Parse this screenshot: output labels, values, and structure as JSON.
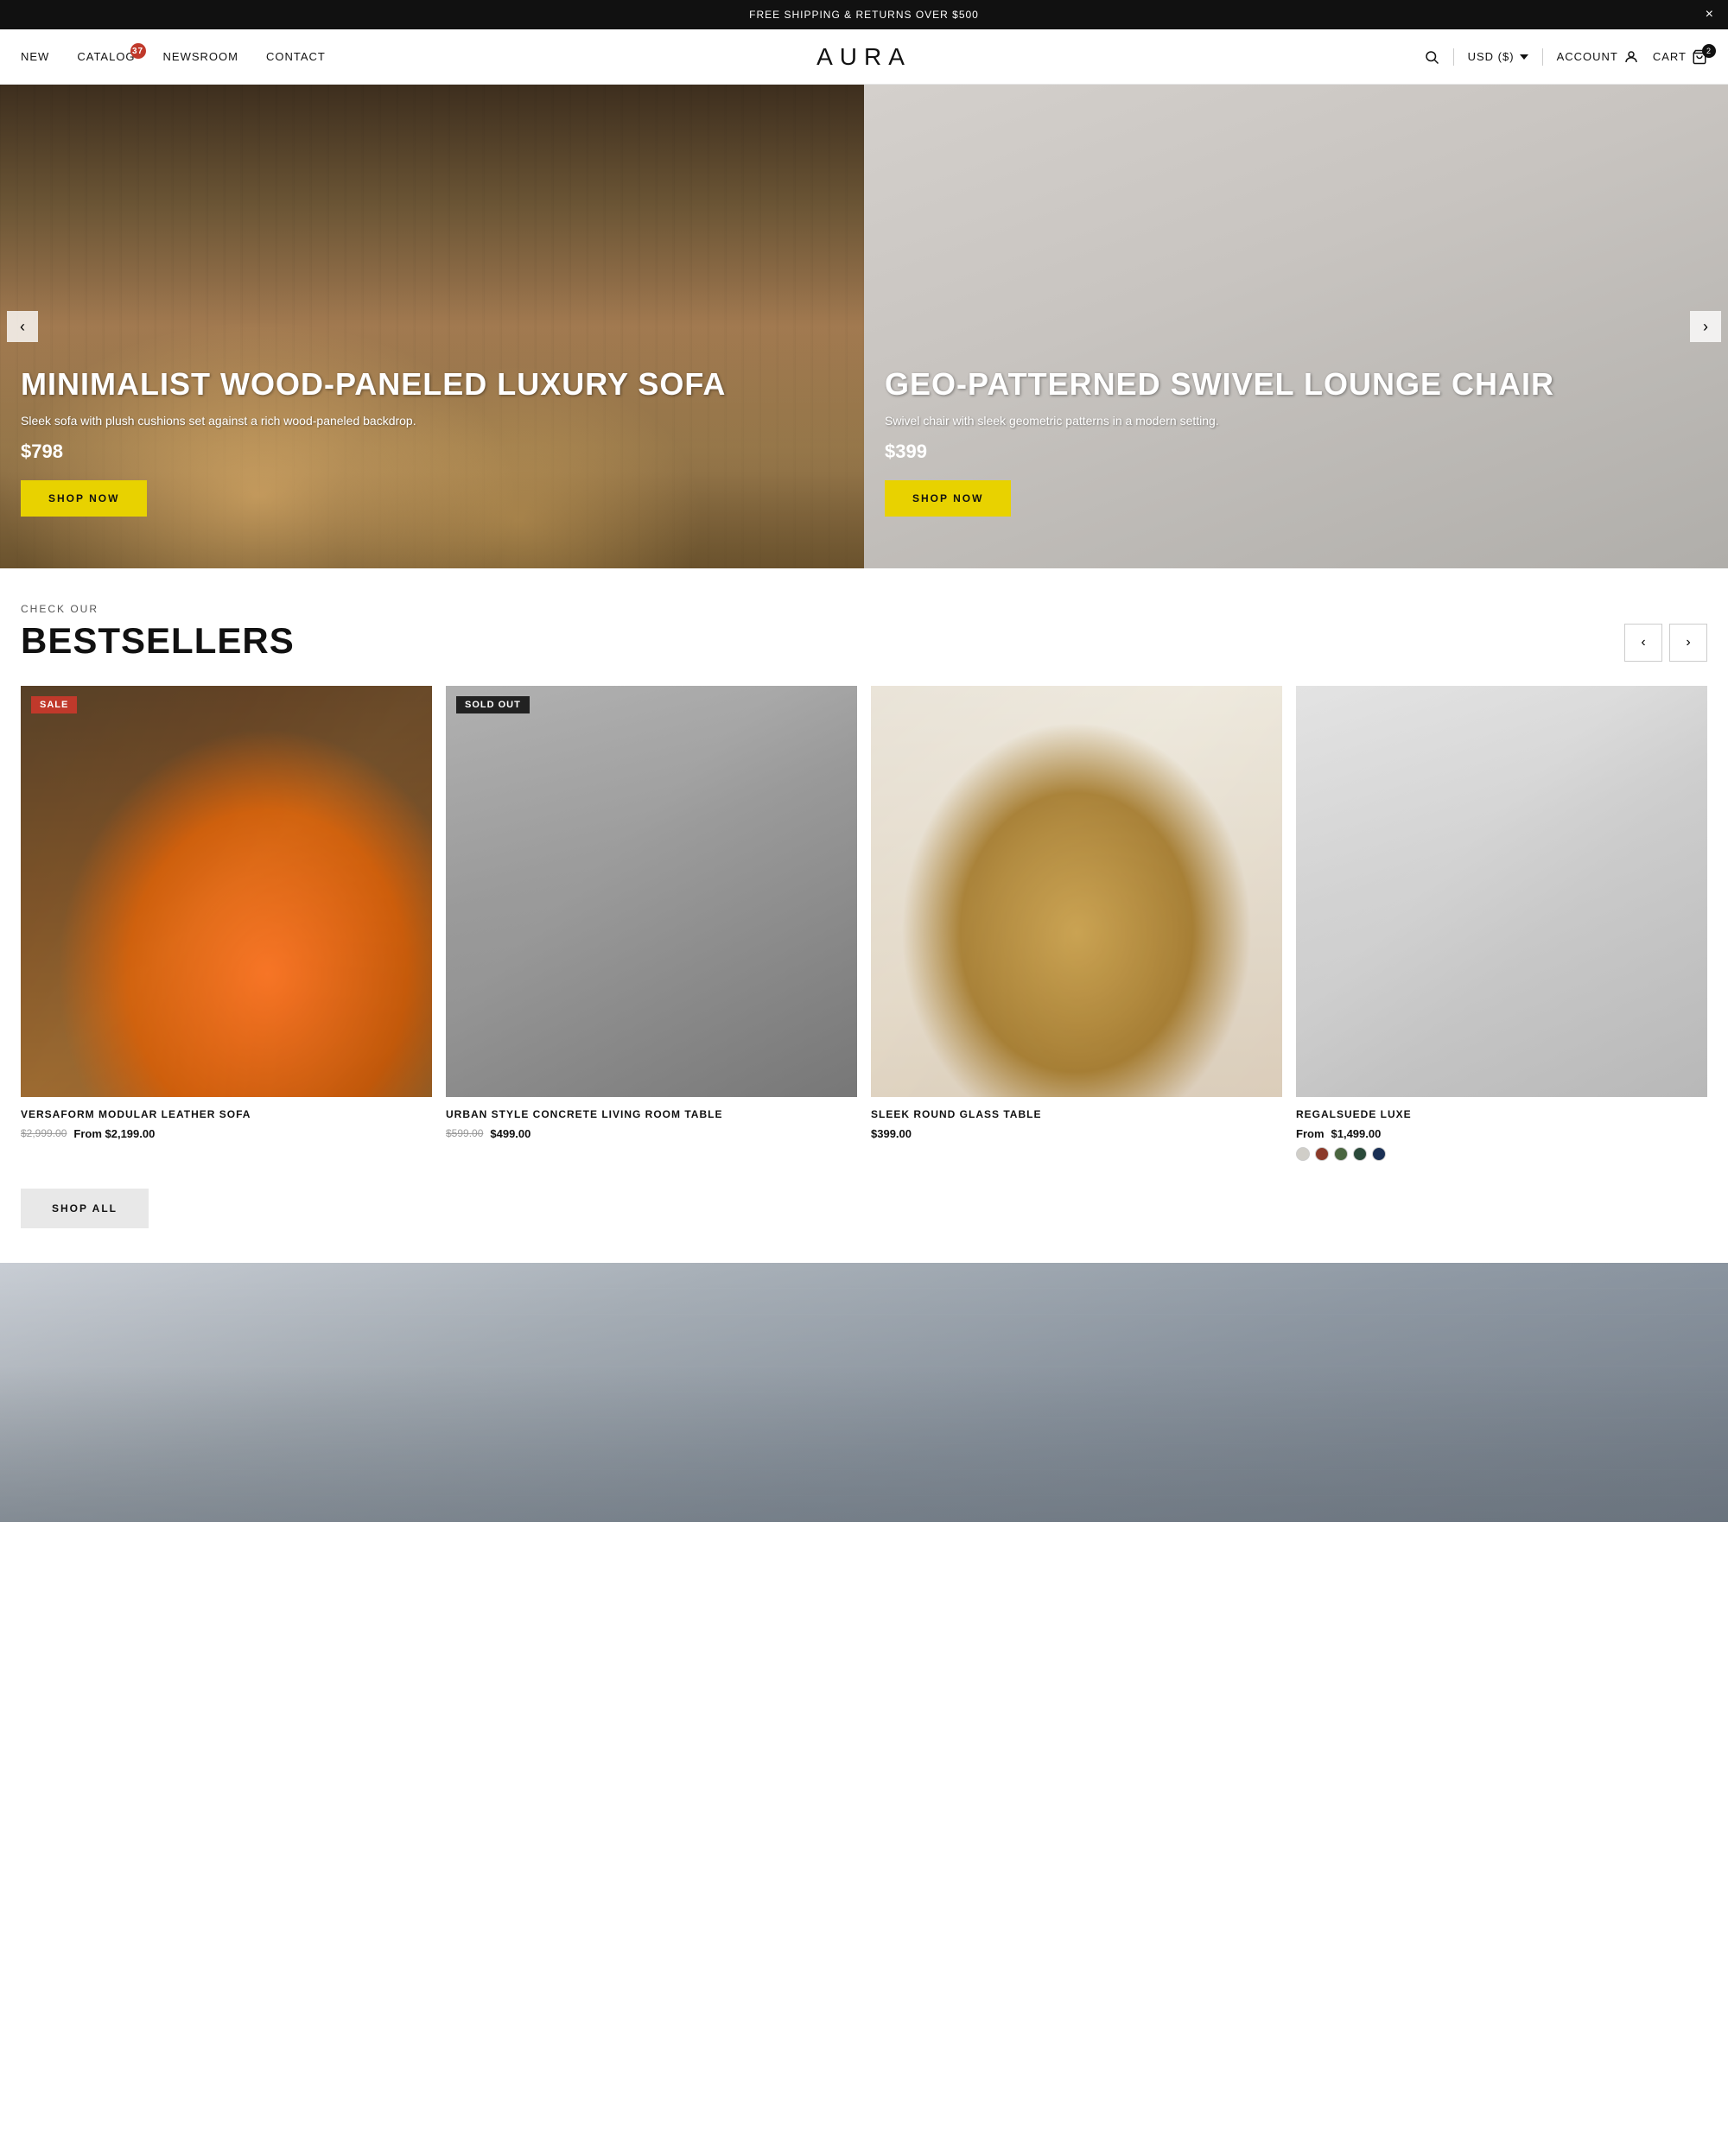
{
  "announcement": {
    "text": "FREE SHIPPING & RETURNS OVER $500",
    "close_label": "×"
  },
  "header": {
    "nav_left": [
      {
        "label": "NEW",
        "href": "#",
        "id": "new"
      },
      {
        "label": "CATALOG",
        "href": "#",
        "id": "catalog",
        "badge": "37"
      },
      {
        "label": "NEWSROOM",
        "href": "#",
        "id": "newsroom"
      },
      {
        "label": "CONTACT",
        "href": "#",
        "id": "contact"
      }
    ],
    "logo": "AURA",
    "nav_right": {
      "search_icon": "🔍",
      "currency": "USD ($)",
      "account_label": "ACCOUNT",
      "cart_label": "CART",
      "cart_count": "2"
    }
  },
  "hero": {
    "prev_label": "‹",
    "next_label": "›",
    "slides": [
      {
        "id": "left",
        "title": "MINIMALIST WOOD-PANELED LUXURY SOFA",
        "description": "Sleek sofa with plush cushions set against a rich wood-paneled backdrop.",
        "price": "$798",
        "cta": "SHOP NOW"
      },
      {
        "id": "right",
        "title": "GEO-PATTERNED SWIVEL LOUNGE CHAIR",
        "description": "Swivel chair with sleek geometric patterns in a modern setting.",
        "price": "$399",
        "cta": "SHOP NOW"
      }
    ]
  },
  "bestsellers": {
    "subtitle": "CHECK OUR",
    "title": "BESTSELLERS",
    "prev_label": "‹",
    "next_label": "›",
    "products": [
      {
        "id": "p1",
        "name": "VERSAFORM MODULAR LEATHER SOFA",
        "price_original": "$2,999.00",
        "price_sale": "From $2,199.00",
        "badge": "SALE",
        "badge_type": "sale",
        "img_class": "product-img-1"
      },
      {
        "id": "p2",
        "name": "URBAN STYLE CONCRETE LIVING ROOM TABLE",
        "price_original": "$599.00",
        "price_sale": "$499.00",
        "badge": "SOLD OUT",
        "badge_type": "sold",
        "img_class": "product-img-2"
      },
      {
        "id": "p3",
        "name": "SLEEK ROUND GLASS TABLE",
        "price_regular": "$399.00",
        "badge": null,
        "img_class": "product-img-3"
      },
      {
        "id": "p4",
        "name": "REGALSUEDE LUXE",
        "price_prefix": "From ",
        "price_regular": "$1,499.00",
        "badge": null,
        "img_class": "product-img-4",
        "swatches": [
          "#d0cec8",
          "#8b3a2a",
          "#4a6640",
          "#2a4a3a",
          "#1a3055"
        ]
      }
    ],
    "shop_all_label": "SHOP ALL"
  }
}
